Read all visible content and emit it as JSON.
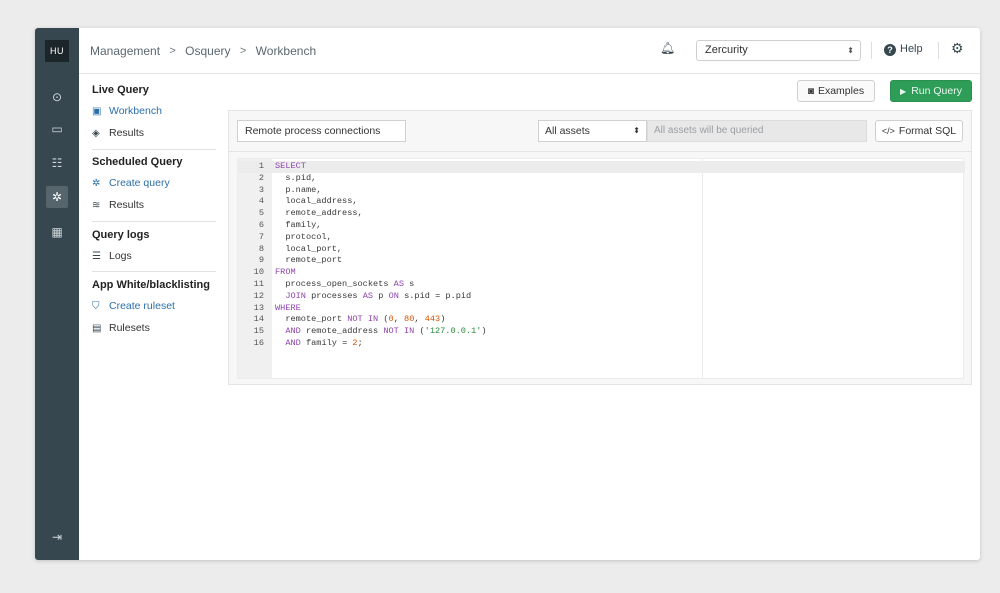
{
  "rail": {
    "logo_text": "HU",
    "icons": [
      "dashboard-icon",
      "monitor-icon",
      "checklist-icon",
      "osquery-icon",
      "building-icon"
    ],
    "logout_icon": "logout-icon"
  },
  "topbar": {
    "breadcrumb": [
      "Management",
      "Osquery",
      "Workbench"
    ],
    "org_select": "Zercurity",
    "help_label": "Help"
  },
  "sidebar": {
    "live_query": {
      "title": "Live Query",
      "items": [
        {
          "label": "Workbench",
          "icon": "window-icon",
          "active": true
        },
        {
          "label": "Results",
          "icon": "eye-icon",
          "active": false
        }
      ]
    },
    "scheduled_query": {
      "title": "Scheduled Query",
      "items": [
        {
          "label": "Create query",
          "icon": "sparkle-icon",
          "active": true
        },
        {
          "label": "Results",
          "icon": "stack-icon",
          "active": false
        }
      ]
    },
    "query_logs": {
      "title": "Query logs",
      "items": [
        {
          "label": "Logs",
          "icon": "list-icon",
          "active": false
        }
      ]
    },
    "app_lists": {
      "title": "App White/blacklisting",
      "items": [
        {
          "label": "Create ruleset",
          "icon": "shield-icon",
          "active": true
        },
        {
          "label": "Rulesets",
          "icon": "grid-icon",
          "active": false
        }
      ]
    }
  },
  "main": {
    "examples_label": "Examples",
    "run_label": "Run Query",
    "query_name": "Remote process connections",
    "asset_select": "All assets",
    "asset_note": "All assets will be queried",
    "format_label": "Format SQL"
  },
  "editor": {
    "line_numbers": [
      "1",
      "2",
      "3",
      "4",
      "5",
      "6",
      "7",
      "8",
      "9",
      "10",
      "11",
      "12",
      "13",
      "14",
      "15",
      "16"
    ],
    "code": [
      "SELECT",
      "  s.pid,",
      "  p.name,",
      "  local_address,",
      "  remote_address,",
      "  family,",
      "  protocol,",
      "  local_port,",
      "  remote_port",
      "FROM",
      "  process_open_sockets AS s",
      "  JOIN processes AS p ON s.pid = p.pid",
      "WHERE",
      "  remote_port NOT IN (0, 80, 443)",
      "  AND remote_address NOT IN ('127.0.0.1')",
      "  AND family = 2;"
    ]
  },
  "colors": {
    "rail": "#37474f",
    "run_button": "#2e9d57",
    "link": "#2b6ea9",
    "keyword": "#8e44ad",
    "number": "#d35400",
    "string": "#27863a"
  }
}
